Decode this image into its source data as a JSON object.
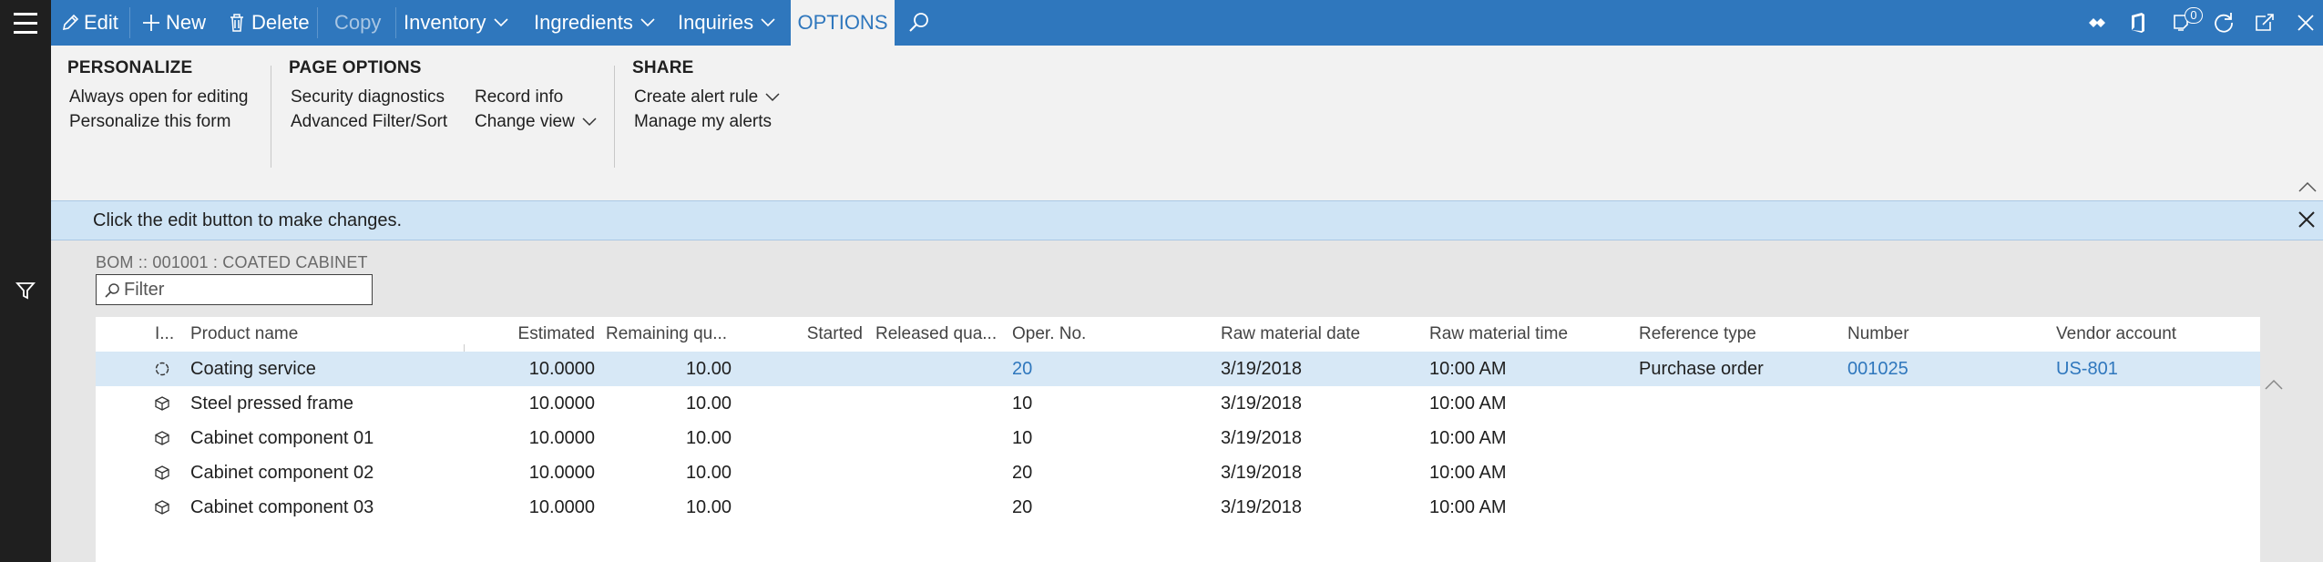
{
  "actionbar": {
    "edit": "Edit",
    "new": "New",
    "delete": "Delete",
    "copy": "Copy",
    "inventory": "Inventory",
    "ingredients": "Ingredients",
    "inquiries": "Inquiries",
    "options": "OPTIONS",
    "notification_count": "0"
  },
  "ribbon": {
    "personalize": {
      "title": "PERSONALIZE",
      "items": [
        "Always open for editing",
        "Personalize this form"
      ]
    },
    "page_options": {
      "title": "PAGE OPTIONS",
      "items": [
        "Security diagnostics",
        "Advanced Filter/Sort",
        "Record info",
        "Change view"
      ]
    },
    "share": {
      "title": "SHARE",
      "items": [
        "Create alert rule",
        "Manage my alerts"
      ]
    }
  },
  "message": "Click the edit button to make changes.",
  "caption": "BOM :: 001001 : COATED CABINET",
  "filter_placeholder": "Filter",
  "grid": {
    "columns": [
      "I...",
      "Product name",
      "Estimated",
      "Remaining qu...",
      "Started",
      "Released qua...",
      "Oper. No.",
      "Raw material date",
      "Raw material time",
      "Reference type",
      "Number",
      "Vendor account"
    ],
    "rows": [
      {
        "icon": "service-icon",
        "product": "Coating service",
        "estimated": "10.0000",
        "remaining": "10.00",
        "started": "",
        "released": "",
        "oper": "20",
        "date": "3/19/2018",
        "time": "10:00 AM",
        "reftype": "Purchase order",
        "number": "001025",
        "vendor": "US-801"
      },
      {
        "icon": "item-box-icon",
        "product": "Steel pressed frame",
        "estimated": "10.0000",
        "remaining": "10.00",
        "started": "",
        "released": "",
        "oper": "10",
        "date": "3/19/2018",
        "time": "10:00 AM",
        "reftype": "",
        "number": "",
        "vendor": ""
      },
      {
        "icon": "item-box-icon",
        "product": "Cabinet component 01",
        "estimated": "10.0000",
        "remaining": "10.00",
        "started": "",
        "released": "",
        "oper": "10",
        "date": "3/19/2018",
        "time": "10:00 AM",
        "reftype": "",
        "number": "",
        "vendor": ""
      },
      {
        "icon": "item-box-icon",
        "product": "Cabinet component 02",
        "estimated": "10.0000",
        "remaining": "10.00",
        "started": "",
        "released": "",
        "oper": "20",
        "date": "3/19/2018",
        "time": "10:00 AM",
        "reftype": "",
        "number": "",
        "vendor": ""
      },
      {
        "icon": "item-box-icon",
        "product": "Cabinet component 03",
        "estimated": "10.0000",
        "remaining": "10.00",
        "started": "",
        "released": "",
        "oper": "20",
        "date": "3/19/2018",
        "time": "10:00 AM",
        "reftype": "",
        "number": "",
        "vendor": ""
      }
    ]
  },
  "colors": {
    "accent": "#2f77bd",
    "selected_row": "#d7e8f6",
    "message_bar": "#cfe4f5"
  }
}
